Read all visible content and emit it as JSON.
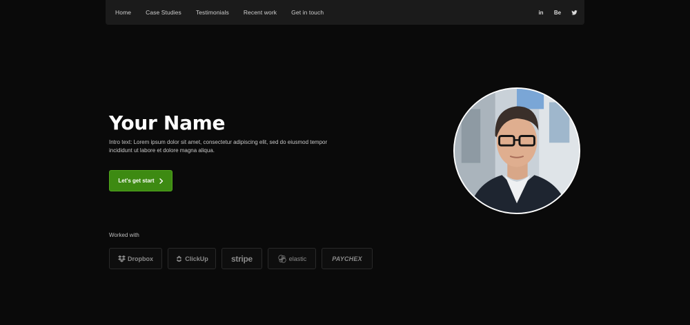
{
  "nav": {
    "links": [
      "Home",
      "Case Studies",
      "Testimonials",
      "Recent work",
      "Get in touch"
    ],
    "social": {
      "linkedin": "in",
      "behance": "Be",
      "twitter_icon": "twitter-bird"
    }
  },
  "hero": {
    "title": "Your Name",
    "intro": "Intro text: Lorem ipsum dolor sit amet, consectetur adipiscing elit, sed do eiusmod tempor incididunt ut labore et dolore magna aliqua.",
    "cta_label": "Let's get start",
    "cta_icon": "chevron-right"
  },
  "worked_with": {
    "label": "Worked with",
    "logos": [
      "Dropbox",
      "ClickUp",
      "stripe",
      "elastic",
      "PAYCHEX"
    ]
  },
  "colors": {
    "background": "#0a0a0a",
    "navbar": "#1b1b1b",
    "accent": "#3d8a12",
    "text": "#ffffff"
  }
}
